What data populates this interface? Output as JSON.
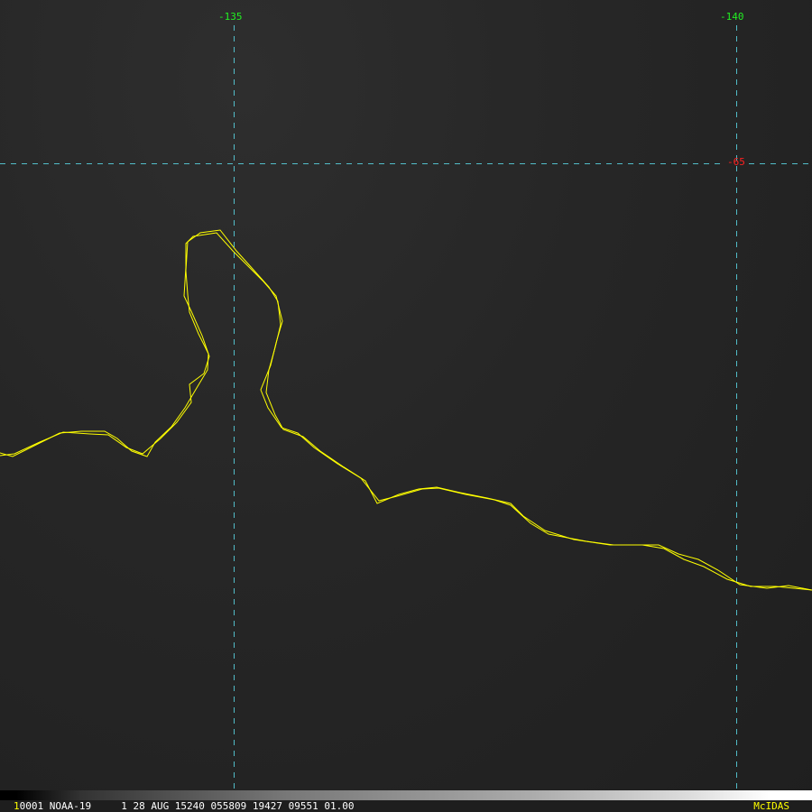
{
  "grid": {
    "lon_labels": [
      "-135",
      "-140"
    ],
    "lat_labels": [
      "-65"
    ],
    "line_color": "#5ad8e6",
    "lon_color": "#22ee22",
    "lat_color": "#ff2020"
  },
  "coast_color": "#ffff00",
  "status": {
    "frame": "1",
    "text": "0001 NOAA-19     1 28 AUG 15240 055809 19427 09551 01.00",
    "brand": "McIDAS"
  }
}
